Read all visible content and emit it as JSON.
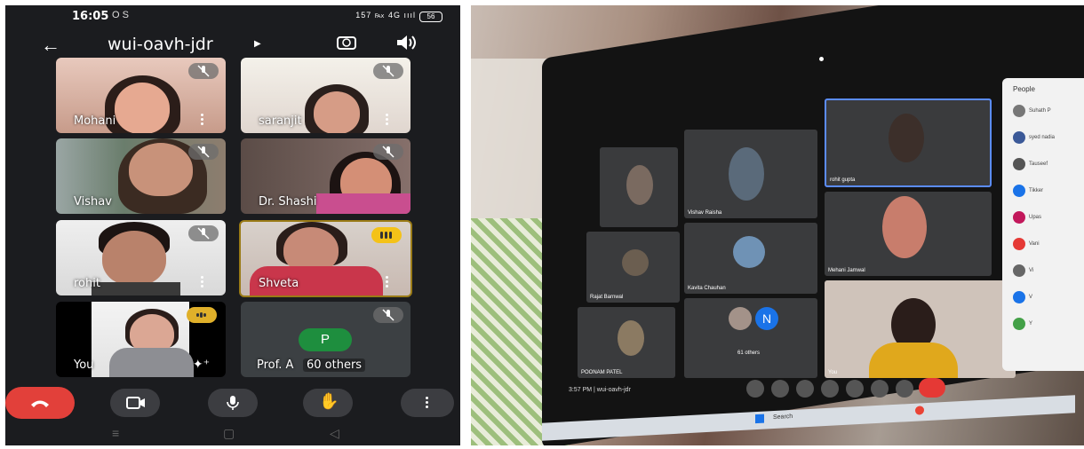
{
  "phone": {
    "status": {
      "time": "16:05",
      "left_icons": "O S",
      "right_icons": "157 ℻ 4G ıııl",
      "battery": "56"
    },
    "meeting_code": "wui-oavh-jdr",
    "participants": [
      {
        "name": "Mohani",
        "muted": true
      },
      {
        "name": "saranjit",
        "muted": true
      },
      {
        "name": "Vishav",
        "muted": true
      },
      {
        "name": "Dr. Shashi",
        "muted": true
      },
      {
        "name": "rohit",
        "muted": true
      },
      {
        "name": "Shveta",
        "speaking": true
      },
      {
        "name": "You",
        "speaking": true
      },
      {
        "name": "Prof. A",
        "avatar_letter": "P",
        "others_label": "60 others",
        "muted": true
      }
    ],
    "controls": [
      "end-call",
      "camera",
      "microphone",
      "raise-hand",
      "more"
    ],
    "nav": [
      "≡",
      "▢",
      "◁"
    ],
    "colors": {
      "end_call": "#e2403a",
      "speaking": "#f4c218",
      "avatar": "#1e8e3e"
    }
  },
  "laptop": {
    "tiles": [
      {
        "name": "rohit gupta"
      },
      {
        "name": "Vishav Raisha"
      },
      {
        "name": "Mehani Jamwal"
      },
      {
        "name": "Kavita Chauhan"
      },
      {
        "name": "Rajat Barnwal"
      },
      {
        "name": "POONAM PATEL"
      },
      {
        "name": "61 others"
      },
      {
        "name": "You"
      },
      {
        "name": "N"
      }
    ],
    "people_title": "People",
    "people": [
      "Suhath P",
      "syed nadia",
      "Tauseef",
      "Tikker",
      "Upas",
      "Vani",
      "Vi",
      "V",
      "Y"
    ],
    "footer": "3:57 PM | wui-oavh-jdr",
    "taskbar_search": "Search"
  }
}
